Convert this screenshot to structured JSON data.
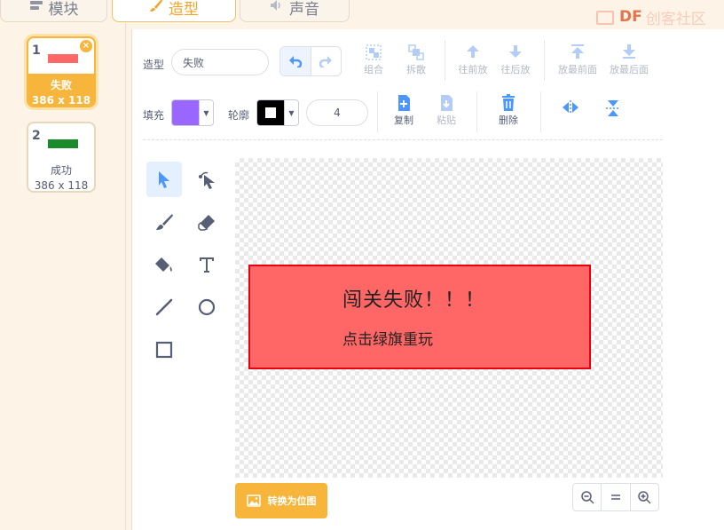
{
  "tabs": [
    {
      "label": "模块",
      "icon": "blocks-icon"
    },
    {
      "label": "造型",
      "icon": "brush-icon"
    },
    {
      "label": "声音",
      "icon": "speaker-icon"
    }
  ],
  "brand": {
    "df": "DF",
    "sub": "创客社区"
  },
  "costumes": [
    {
      "number": "1",
      "name": "失败",
      "size": "386 x 118",
      "selected": true,
      "thumb_color": "#ff6666"
    },
    {
      "number": "2",
      "name": "成功",
      "size": "386 x 118",
      "selected": false,
      "thumb_color": "#1a8a2a"
    }
  ],
  "toolbar": {
    "costume_label": "造型",
    "costume_name": "失败",
    "group": "组合",
    "ungroup": "拆散",
    "forward": "往前放",
    "backward": "往后放",
    "front": "放最前面",
    "back": "放最后面",
    "fill_label": "填充",
    "fill_color": "#9966ff",
    "outline_label": "轮廓",
    "outline_width": "4",
    "copy": "复制",
    "paste": "粘贴",
    "delete": "删除"
  },
  "canvas": {
    "title_text": "闯关失败！！！",
    "subtitle_text": "点击绿旗重玩",
    "fill": "#ff6666",
    "stroke": "#e8000e"
  },
  "bottom": {
    "convert_bitmap": "转换为位图"
  }
}
